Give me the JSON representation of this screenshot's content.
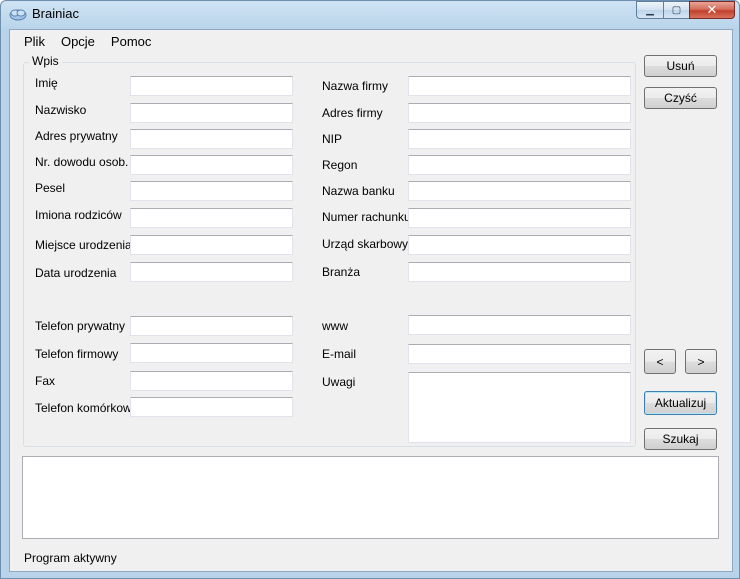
{
  "window": {
    "title": "Brainiac"
  },
  "caption": {
    "minimize": "▁",
    "maximize": "▢",
    "close": "✕"
  },
  "menu": {
    "items": [
      "Plik",
      "Opcje",
      "Pomoc"
    ]
  },
  "group": {
    "title": "Wpis"
  },
  "left_fields": [
    {
      "label": "Imię",
      "value": ""
    },
    {
      "label": "Nazwisko",
      "value": ""
    },
    {
      "label": "Adres prywatny",
      "value": ""
    },
    {
      "label": "Nr. dowodu osob.",
      "value": ""
    },
    {
      "label": "Pesel",
      "value": ""
    },
    {
      "label": "Imiona rodziców",
      "value": ""
    },
    {
      "label": "Miejsce urodzenia",
      "value": ""
    },
    {
      "label": "Data urodzenia",
      "value": ""
    },
    {
      "label": "Telefon prywatny",
      "value": ""
    },
    {
      "label": "Telefon firmowy",
      "value": ""
    },
    {
      "label": "Fax",
      "value": ""
    },
    {
      "label": "Telefon komórkowy",
      "value": ""
    }
  ],
  "right_fields": [
    {
      "label": "Nazwa firmy",
      "value": ""
    },
    {
      "label": "Adres firmy",
      "value": ""
    },
    {
      "label": "NIP",
      "value": ""
    },
    {
      "label": "Regon",
      "value": ""
    },
    {
      "label": "Nazwa banku",
      "value": ""
    },
    {
      "label": "Numer rachunku",
      "value": ""
    },
    {
      "label": "Urząd skarbowy",
      "value": ""
    },
    {
      "label": "Branża",
      "value": ""
    },
    {
      "label": "www",
      "value": ""
    },
    {
      "label": "E-mail",
      "value": ""
    },
    {
      "label": "Uwagi",
      "value": ""
    }
  ],
  "buttons": {
    "delete": "Usuń",
    "clear": "Czyść",
    "prev": "<",
    "next": ">",
    "update": "Aktualizuj",
    "search": "Szukaj"
  },
  "log": {
    "value": ""
  },
  "status": {
    "text": "Program aktywny"
  }
}
